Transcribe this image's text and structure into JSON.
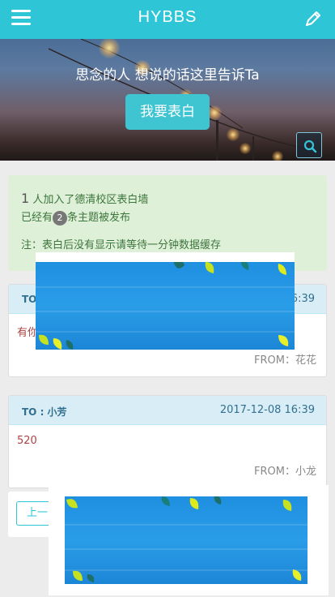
{
  "header": {
    "title": "HYBBS",
    "menu_icon": "hamburger-menu-icon",
    "edit_icon": "pencil-icon"
  },
  "hero": {
    "tagline": "思念的人 想说的话这里告诉Ta",
    "cta_label": "我要表白",
    "search_icon": "search-icon"
  },
  "notice": {
    "joined_count": "1",
    "joined_text": "人加入了德清校区表白墙",
    "topics_prefix": "已经有",
    "topics_count": "2",
    "topics_suffix": "条主题被发布",
    "note": "注：表白后没有显示请等待一分钟数据缓存"
  },
  "posts": [
    {
      "to": "TO",
      "date": "16:39",
      "body": "有你",
      "from": "FROM：花花"
    },
    {
      "to": "TO : 小芳",
      "date": "2017-12-08 16:39",
      "body": "520",
      "from": "FROM：小龙"
    }
  ],
  "pager": {
    "prev_label": "上一"
  },
  "colors": {
    "brand": "#2ec6d6",
    "notice_bg": "#dff0d8",
    "card_head_bg": "#d9edf7",
    "ad_blue": "#1f8fe0"
  }
}
